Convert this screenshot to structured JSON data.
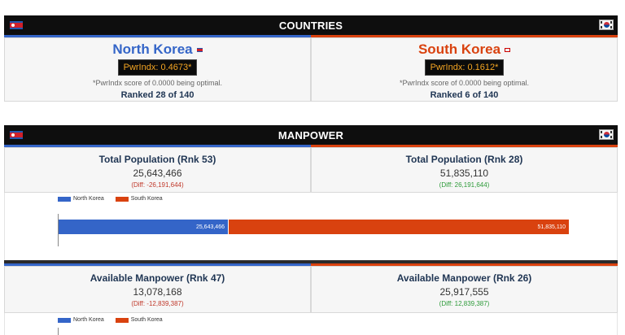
{
  "countries_section": {
    "title": "COUNTRIES",
    "north": {
      "name": "North Korea",
      "pwr_index": "PwrIndx: 0.4673*",
      "note": "*PwrIndx score of 0.0000 being optimal.",
      "ranked": "Ranked 28 of 140"
    },
    "south": {
      "name": "South Korea",
      "pwr_index": "PwrIndx: 0.1612*",
      "note": "*PwrIndx score of 0.0000 being optimal.",
      "ranked": "Ranked 6 of 140"
    }
  },
  "manpower_section": {
    "title": "MANPOWER",
    "total_population": {
      "north_title": "Total Population (Rnk 53)",
      "north_value": "25,643,466",
      "north_diff": "(Diff: -26,191,644)",
      "south_title": "Total Population (Rnk 28)",
      "south_value": "51,835,110",
      "south_diff": "(Diff: 26,191,644)",
      "legend_north": "North Korea",
      "legend_south": "South Korea",
      "bar_north_label": "25,643,466",
      "bar_south_label": "51,835,110",
      "north_share": 0.331,
      "south_share": 0.669
    },
    "available_manpower": {
      "north_title": "Available Manpower (Rnk 47)",
      "north_value": "13,078,168",
      "north_diff": "(Diff: -12,839,387)",
      "south_title": "Available Manpower (Rnk 26)",
      "south_value": "25,917,555",
      "south_diff": "(Diff: 12,839,387)",
      "legend_north": "North Korea",
      "legend_south": "South Korea"
    }
  },
  "colors": {
    "north": "#3465c8",
    "south": "#d9420f",
    "header_bg": "#0e0e0e"
  },
  "icons": {
    "north_flag": "north-korea-flag-icon",
    "south_flag": "south-korea-flag-icon"
  }
}
